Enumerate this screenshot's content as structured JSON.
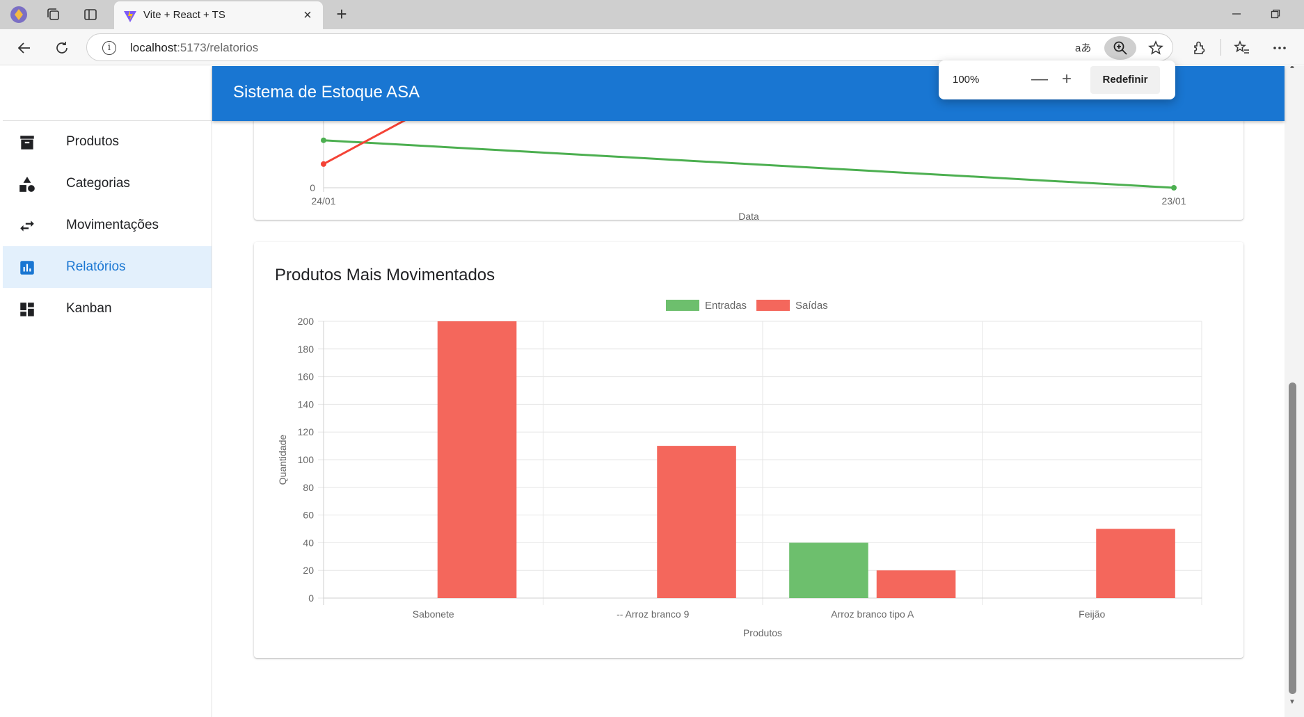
{
  "browser": {
    "tab_title": "Vite + React + TS",
    "tab_close_glyph": "×",
    "new_tab_glyph": "+",
    "url_host": "localhost",
    "url_path": ":5173/relatorios",
    "icons": [
      "profile-icon",
      "workspaces-icon",
      "tab-actions-icon",
      "vite-favicon",
      "back-icon",
      "refresh-icon",
      "info-icon",
      "read-aloud-icon",
      "zoom-icon",
      "favorite-star-icon",
      "extensions-icon",
      "favorites-icon",
      "more-icon",
      "minimize-icon",
      "restore-icon"
    ]
  },
  "zoom_popup": {
    "value": "100%",
    "decrease_glyph": "—",
    "increase_glyph": "+",
    "reset_label": "Redefinir"
  },
  "app": {
    "title": "Sistema de Estoque ASA",
    "accent_color": "#1976d2"
  },
  "sidebar": {
    "items": [
      {
        "label": "Produtos",
        "icon": "archive-icon",
        "active": false
      },
      {
        "label": "Categorias",
        "icon": "category-shapes-icon",
        "active": false
      },
      {
        "label": "Movimentações",
        "icon": "swap-arrows-icon",
        "active": false
      },
      {
        "label": "Relatórios",
        "icon": "bar-chart-icon",
        "active": true
      },
      {
        "label": "Kanban",
        "icon": "dashboard-icon",
        "active": false
      }
    ]
  },
  "chart_data": [
    {
      "type": "line",
      "title": "",
      "xlabel": "Data",
      "ylabel": "",
      "x": [
        "24/01",
        "23/01"
      ],
      "visible_y_ticks": [
        0
      ],
      "series": [
        {
          "color": "#4caf50",
          "values": [
            40,
            0
          ]
        },
        {
          "color": "#f44336",
          "values": [
            20,
            null
          ]
        }
      ]
    },
    {
      "type": "bar",
      "title": "Produtos Mais Movimentados",
      "xlabel": "Produtos",
      "ylabel": "Quantidade",
      "categories": [
        "Sabonete",
        "-- Arroz branco 9",
        "Arroz branco tipo A",
        "Feijão"
      ],
      "ylim": [
        0,
        200
      ],
      "y_ticks": [
        0,
        20,
        40,
        60,
        80,
        100,
        120,
        140,
        160,
        180,
        200
      ],
      "legend_position": "top",
      "grid": true,
      "series": [
        {
          "name": "Entradas",
          "color": "#6dbf6d",
          "values": [
            0,
            0,
            40,
            0
          ]
        },
        {
          "name": "Saídas",
          "color": "#f4675c",
          "values": [
            200,
            110,
            20,
            50
          ]
        }
      ]
    }
  ]
}
